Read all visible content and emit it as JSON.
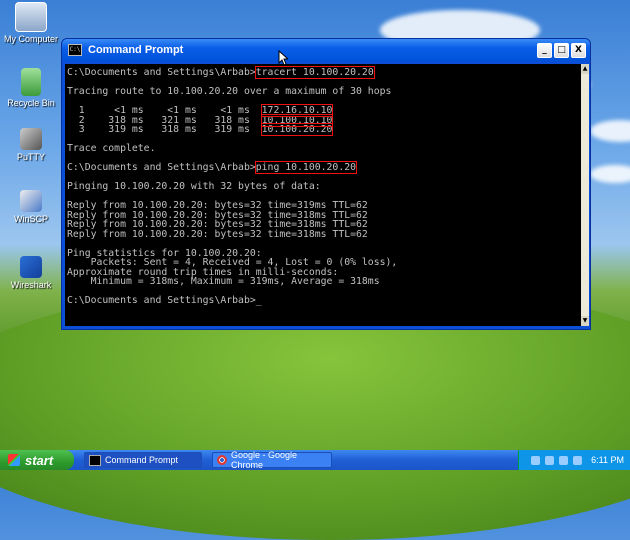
{
  "desktop": {
    "icons": [
      {
        "label": "My Computer",
        "icon": "my-computer-icon"
      },
      {
        "label": "Recycle Bin",
        "icon": "recycle-bin-icon"
      },
      {
        "label": "PuTTY",
        "icon": "putty-icon"
      },
      {
        "label": "WinSCP",
        "icon": "winscp-icon"
      },
      {
        "label": "Wireshark",
        "icon": "wireshark-icon"
      }
    ]
  },
  "window": {
    "title": "Command Prompt",
    "app_icon_text": "C:\\",
    "minimize": "_",
    "maximize": "□",
    "close": "X"
  },
  "console": {
    "prompt": "C:\\Documents and Settings\\Arbab>",
    "tracert_cmd": "tracert 10.100.20.20",
    "tracing_line": "Tracing route to 10.100.20.20 over a maximum of 30 hops",
    "hops": [
      {
        "prefix": "  1     <1 ms    <1 ms    <1 ms  ",
        "ip": "172.16.10.10"
      },
      {
        "prefix": "  2    318 ms   321 ms   318 ms  ",
        "ip": "10.100.10.10"
      },
      {
        "prefix": "  3    319 ms   318 ms   319 ms  ",
        "ip": "10.100.20.20"
      }
    ],
    "trace_complete": "Trace complete.",
    "ping_cmd": "ping 10.100.20.20",
    "pinging_line": "Pinging 10.100.20.20 with 32 bytes of data:",
    "replies": [
      "Reply from 10.100.20.20: bytes=32 time=319ms TTL=62",
      "Reply from 10.100.20.20: bytes=32 time=318ms TTL=62",
      "Reply from 10.100.20.20: bytes=32 time=318ms TTL=62",
      "Reply from 10.100.20.20: bytes=32 time=318ms TTL=62"
    ],
    "stats": [
      "Ping statistics for 10.100.20.20:",
      "    Packets: Sent = 4, Received = 4, Lost = 0 (0% loss),",
      "Approximate round trip times in milli-seconds:",
      "    Minimum = 318ms, Maximum = 319ms, Average = 318ms"
    ],
    "cursor": "_"
  },
  "taskbar": {
    "start_label": "start",
    "tasks": [
      {
        "label": "Command Prompt",
        "icon": "cmd-icon",
        "active": true
      },
      {
        "label": "Google - Google Chrome",
        "icon": "chrome-icon",
        "active": false
      }
    ],
    "clock": "6:11 PM"
  },
  "colors": {
    "highlight": "#ee1111",
    "console_text": "#c0c0c0",
    "console_bg": "#000000"
  }
}
